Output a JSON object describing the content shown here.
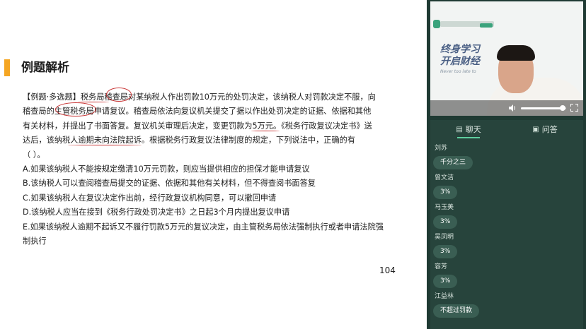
{
  "slide": {
    "title": "例题解析",
    "question_lines": [
      "【例题·多选题】税务局稽查局对某纳税人作出罚款10万元的处罚决定，该纳税人对罚款决定不服，向",
      "稽查局的主管税务局申请复议。稽查局依法向复议机关提交了据以作出处罚决定的证据、依据和其他",
      "有关材料，并提出了书面答复。复议机关审理后决定，变更罚款为5万元。《税务行政复议决定书》送",
      "达后，该纳税人逾期未向法院起诉。根据税务行政复议法律制度的规定，下列说法中，正确的有",
      "（    ）。"
    ],
    "options": [
      "A.如果该纳税人不能按规定缴清10万元罚款，则应当提供相应的担保才能申请复议",
      "B.该纳税人可以查阅稽查局提交的证据、依据和其他有关材料，但不得查阅书面答复",
      "C.如果该纳税人在复议决定作出前，经行政复议机构同意，可以撤回申请",
      "D.该纳税人应当在接到《税务行政处罚决定书》之日起3个月内提出复议申请",
      "E.如果该纳税人逾期不起诉又不履行罚款5万元的复议决定，由主管税务局依法强制执行或者申请法院强制执行"
    ],
    "page_number": "104",
    "accent_color": "#f5a623",
    "annotation_color": "#c83232"
  },
  "video": {
    "slogan_line1": "终身学习",
    "slogan_line2": "开启财经",
    "slogan_en": "Never too late to",
    "volume_fraction": 0.92
  },
  "chat": {
    "tabs": [
      {
        "icon": "chat-icon",
        "label": "聊天",
        "active": true
      },
      {
        "icon": "qa-icon",
        "label": "问答",
        "active": false
      }
    ],
    "messages": [
      {
        "name": "刘苏",
        "text": "千分之三"
      },
      {
        "name": "曾文洁",
        "text": "3%"
      },
      {
        "name": "马玉美",
        "text": "3%"
      },
      {
        "name": "吴凤明",
        "text": "3%"
      },
      {
        "name": "容芳",
        "text": "3%"
      },
      {
        "name": "江益林",
        "text": "不超过罚款"
      }
    ]
  }
}
